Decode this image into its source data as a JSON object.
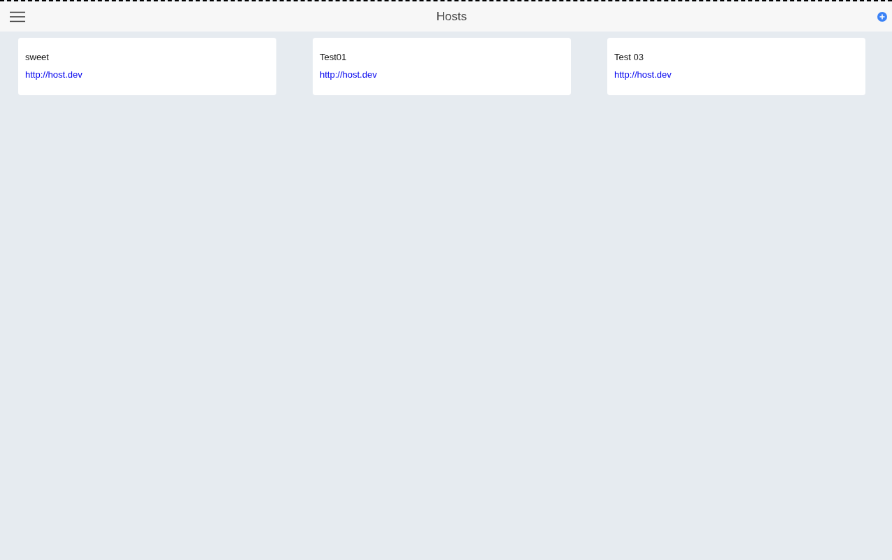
{
  "header": {
    "title": "Hosts"
  },
  "hosts": [
    {
      "name": "sweet",
      "url": "http://host.dev"
    },
    {
      "name": "Test01",
      "url": "http://host.dev"
    },
    {
      "name": "Test 03",
      "url": "http://host.dev"
    }
  ]
}
